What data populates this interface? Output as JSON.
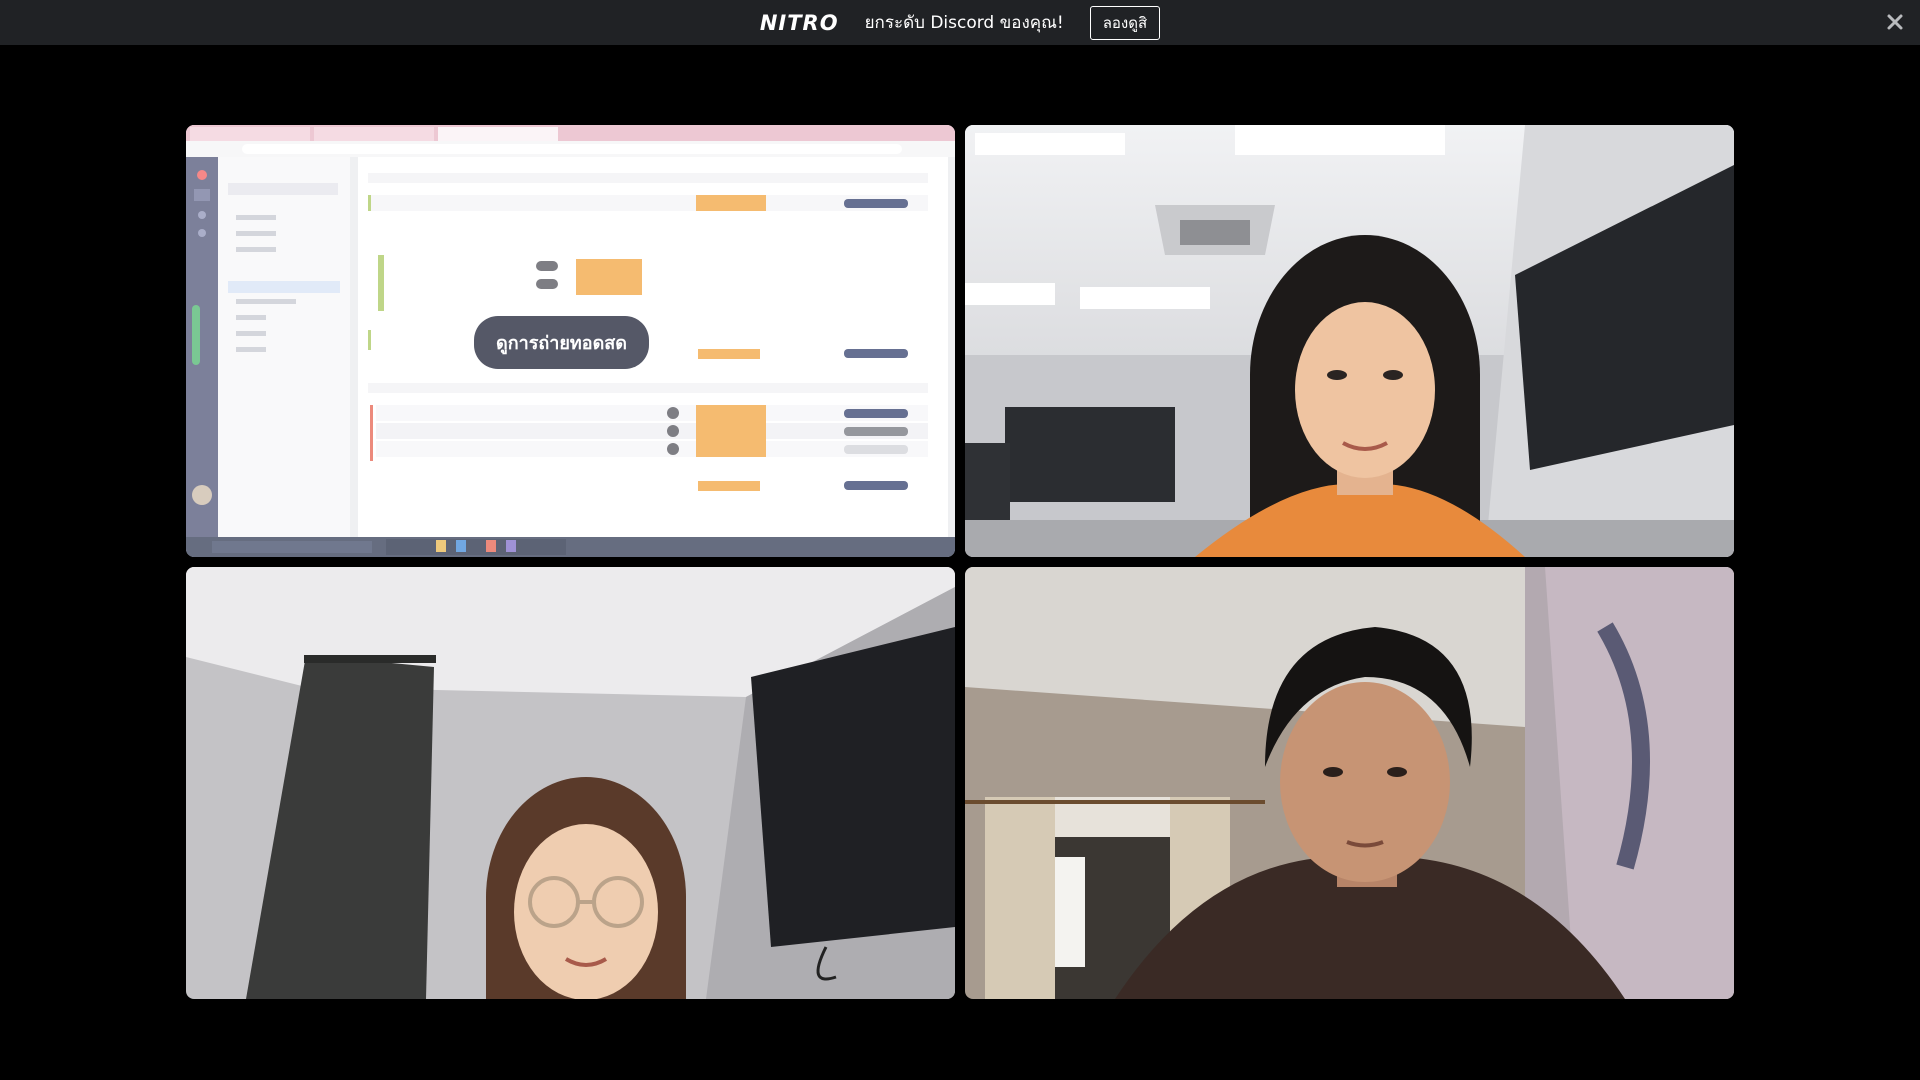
{
  "banner": {
    "logo": "NITRO",
    "message": "ยกระดับ Discord ของคุณ!",
    "cta_label": "ลองดูสิ",
    "close_icon": "close-icon",
    "background": "#202225"
  },
  "stream_tile": {
    "watch_label": "ดูการถ่ายทอดสด"
  },
  "tiles": [
    {
      "kind": "screen-share"
    },
    {
      "kind": "webcam"
    },
    {
      "kind": "webcam"
    },
    {
      "kind": "webcam"
    }
  ],
  "colors": {
    "background": "#000000",
    "accent_orange": "#f2a13a"
  }
}
